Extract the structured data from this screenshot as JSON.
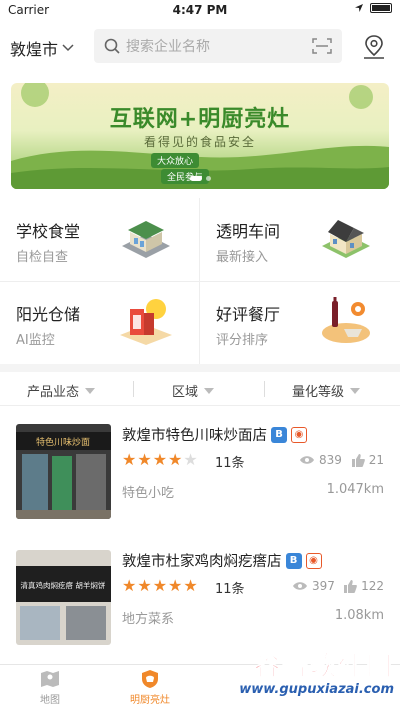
{
  "status": {
    "carrier": "Carrier",
    "time": "4:47 PM"
  },
  "header": {
    "city": "敦煌市",
    "search_placeholder": "搜索企业名称"
  },
  "banner": {
    "title": "互联网+明厨亮灶",
    "subtitle": "看得见的食品安全",
    "tag1": "大众放心",
    "tag2": "全民参与"
  },
  "categories": [
    {
      "title": "学校食堂",
      "subtitle": "自检自查",
      "icon": "school-canteen-icon"
    },
    {
      "title": "透明车间",
      "subtitle": "最新接入",
      "icon": "workshop-icon"
    },
    {
      "title": "阳光仓储",
      "subtitle": "AI监控",
      "icon": "warehouse-icon"
    },
    {
      "title": "好评餐厅",
      "subtitle": "评分排序",
      "icon": "restaurant-icon"
    }
  ],
  "filters": [
    "产品业态",
    "区域",
    "量化等级"
  ],
  "restaurants": [
    {
      "name": "敦煌市特色川味炒面店",
      "badges": [
        "B"
      ],
      "rating": 4,
      "reviews": "11条",
      "views": "839",
      "likes": "21",
      "category": "特色小吃",
      "distance": "1.047km",
      "sign_text": "特色川味炒面"
    },
    {
      "name": "敦煌市杜家鸡肉焖疙瘩店",
      "badges": [
        "B"
      ],
      "rating": 5,
      "reviews": "11条",
      "views": "397",
      "likes": "122",
      "category": "地方菜系",
      "distance": "1.08km",
      "sign_text": "清真鸡肉焖疙瘩 胡羊焖饼"
    }
  ],
  "tabs": [
    {
      "label": "地图",
      "active": false
    },
    {
      "label": "明厨亮灶",
      "active": true
    }
  ],
  "watermark": {
    "name": "谷普软件园",
    "url": "www.gupuxiazai.com"
  },
  "colors": {
    "accent": "#f0882a",
    "star": "#f0882a",
    "badge_blue": "#3a86d8",
    "badge_orange": "#e8592a"
  }
}
